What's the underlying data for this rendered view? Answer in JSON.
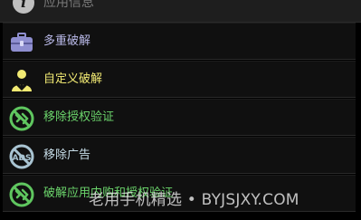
{
  "header": {
    "title": "应用信息",
    "icon": "info-icon",
    "icon_glyph": "i"
  },
  "menu": {
    "items": [
      {
        "label": "多重破解",
        "icon": "toolbox-icon",
        "color": "#b9b9e8"
      },
      {
        "label": "自定义破解",
        "icon": "download-person-icon",
        "color": "#f2ea73"
      },
      {
        "label": "移除授权验证",
        "icon": "no-auth-icon",
        "color": "#6bd46b"
      },
      {
        "label": "移除广告",
        "icon": "no-ads-icon",
        "color": "#c7dde8"
      },
      {
        "label": "破解应用内购和授权验证",
        "icon": "no-purchase-icon",
        "color": "#6bd46b"
      }
    ]
  },
  "watermark": {
    "text": "老用手机精选 • BYJSJXY.COM"
  },
  "colors": {
    "background": "#000000",
    "item_bg": "#101010",
    "green": "#5fc65f",
    "yellow": "#f2ea73",
    "purple": "#8f8fd0"
  }
}
